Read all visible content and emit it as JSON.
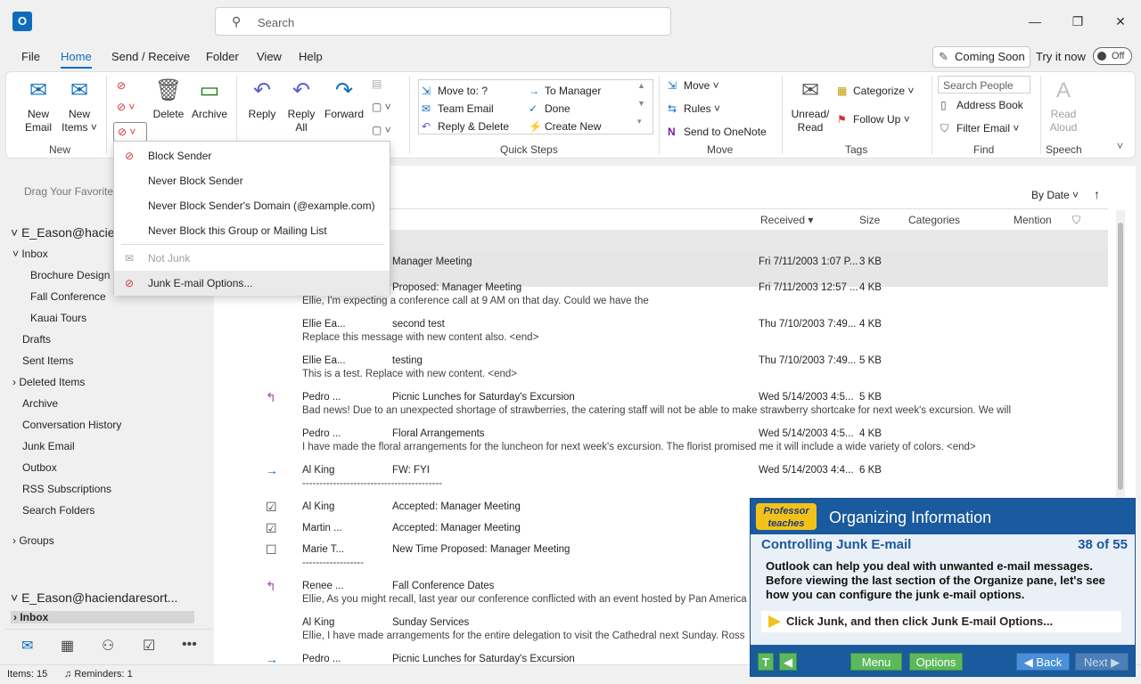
{
  "titlebar": {
    "app_icon": "O",
    "search_placeholder": "Search",
    "minimize": "—",
    "maximize": "❐",
    "close": "✕"
  },
  "menu_tabs": [
    "File",
    "Home",
    "Send / Receive",
    "Folder",
    "View",
    "Help"
  ],
  "active_tab": "Home",
  "coming_soon": "Coming Soon",
  "try_it_now": "Try it now",
  "toggle": "Off",
  "ribbon": {
    "new_email": [
      "New",
      "Email"
    ],
    "new_items": [
      "New",
      "Items"
    ],
    "delete": "Delete",
    "archive": "Archive",
    "group_new": "New",
    "reply": "Reply",
    "reply_all": [
      "Reply",
      "All"
    ],
    "forward": "Forward",
    "quick_steps": [
      "Move to: ?",
      "To Manager",
      "Team Email",
      "Done",
      "Reply & Delete",
      "Create New"
    ],
    "group_quick_steps": "Quick Steps",
    "move": "Move",
    "rules": "Rules",
    "send_onenote": "Send to OneNote",
    "group_move": "Move",
    "unread_read": [
      "Unread/",
      "Read"
    ],
    "categorize": "Categorize",
    "follow_up": "Follow Up",
    "group_tags": "Tags",
    "search_people": "Search People",
    "address_book": "Address Book",
    "filter_email": "Filter Email",
    "group_find": "Find",
    "read_aloud": [
      "Read",
      "Aloud"
    ],
    "group_speech": "Speech"
  },
  "junk_menu": {
    "items": [
      "Block Sender",
      "Never Block Sender",
      "Never Block Sender's Domain (@example.com)",
      "Never Block this Group or Mailing List",
      "Not Junk",
      "Junk E-mail Options..."
    ]
  },
  "nav": {
    "drag_favorite": "Drag Your Favorite",
    "account1": "E_Eason@hacie",
    "inbox": "Inbox",
    "folders": [
      "Brochure Design",
      "Fall Conference",
      "Kauai Tours"
    ],
    "top_folders": [
      "Drafts",
      "Sent Items",
      "Deleted Items",
      "Archive",
      "Conversation History",
      "Junk Email",
      "Outbox",
      "RSS Subscriptions",
      "Search Folders"
    ],
    "groups": "Groups",
    "account2": "E_Eason@haciendaresort...",
    "inbox2": "Inbox"
  },
  "list": {
    "sort": "By Date",
    "columns": [
      "Received",
      "Size",
      "Categories",
      "Mention"
    ],
    "rows": [
      {
        "icon": "",
        "from": "",
        "subject": "Manager Meeting",
        "received": "Fri 7/11/2003 1:07 P...",
        "size": "3 KB",
        "preview": ""
      },
      {
        "icon": "",
        "from": "",
        "subject": "Proposed: Manager Meeting",
        "received": "Fri 7/11/2003 12:57 ...",
        "size": "4 KB",
        "preview": "Ellie,  I'm expecting a conference call at 9 AM on that day. Could we have the"
      },
      {
        "icon": "",
        "from": "Ellie Ea...",
        "subject": "second test",
        "received": "Thu 7/10/2003 7:49...",
        "size": "4 KB",
        "preview": "Replace this message with new content also. <end>"
      },
      {
        "icon": "",
        "from": "Ellie Ea...",
        "subject": "testing",
        "received": "Thu 7/10/2003 7:49...",
        "size": "5 KB",
        "preview": "This is a test.  Replace with new content. <end>"
      },
      {
        "icon": "↰",
        "from": "Pedro ...",
        "subject": "Picnic Lunches for Saturday's Excursion",
        "received": "Wed 5/14/2003 4:5...",
        "size": "5 KB",
        "preview": "Bad news! Due to an unexpected shortage of strawberries, the catering  staff will not be able to make strawberry shortcake for next week's  excursion. We will"
      },
      {
        "icon": "",
        "from": "Pedro ...",
        "subject": "Floral Arrangements",
        "received": "Wed 5/14/2003 4:5...",
        "size": "4 KB",
        "preview": "I have made the floral arrangements for the luncheon for next week's  excursion. The florist promised me it will include a wide variety of  colors.  <end>"
      },
      {
        "icon": "→",
        "from": "Al King",
        "subject": "FW: FYI",
        "received": "Wed 5/14/2003 4:4...",
        "size": "6 KB",
        "preview": "-----------------------------------------"
      },
      {
        "icon": "☑",
        "from": "Al King",
        "subject": "Accepted: Manager Meeting",
        "received": "",
        "size": "",
        "preview": ""
      },
      {
        "icon": "☑",
        "from": "Martin ...",
        "subject": "Accepted: Manager Meeting",
        "received": "",
        "size": "",
        "preview": ""
      },
      {
        "icon": "☐",
        "from": "Marie T...",
        "subject": "New Time Proposed: Manager Meeting",
        "received": "",
        "size": "",
        "preview": "------------------"
      },
      {
        "icon": "↰",
        "from": "Renee ...",
        "subject": "Fall Conference Dates",
        "received": "",
        "size": "",
        "preview": "Ellie,  As you might recall, last year our conference conflicted with an event hosted by Pan America"
      },
      {
        "icon": "",
        "from": "Al King",
        "subject": "Sunday Services",
        "received": "",
        "size": "",
        "preview": "Ellie,  I have made arrangements for the entire delegation to visit the Cathedral next Sunday. Ross"
      },
      {
        "icon": "→",
        "from": "Pedro ...",
        "subject": "Picnic Lunches for Saturday's Excursion",
        "received": "",
        "size": "",
        "preview": ""
      }
    ]
  },
  "status": {
    "items": "Items: 15",
    "reminders": "Reminders: 1"
  },
  "tutorial": {
    "logo": "Professor teaches",
    "title": "Organizing Information",
    "subtitle": "Controlling Junk E-mail",
    "progress": "38 of 55",
    "body": "Outlook can help you deal with unwanted e-mail messages. Before viewing the last section of the Organize pane, let's see how you can configure the junk e-mail options.",
    "instruction": "Click Junk, and then click Junk E-mail Options...",
    "btn_t": "T",
    "btn_menu": "Menu",
    "btn_options": "Options",
    "btn_back": "◀ Back",
    "btn_next": "Next ▶"
  }
}
